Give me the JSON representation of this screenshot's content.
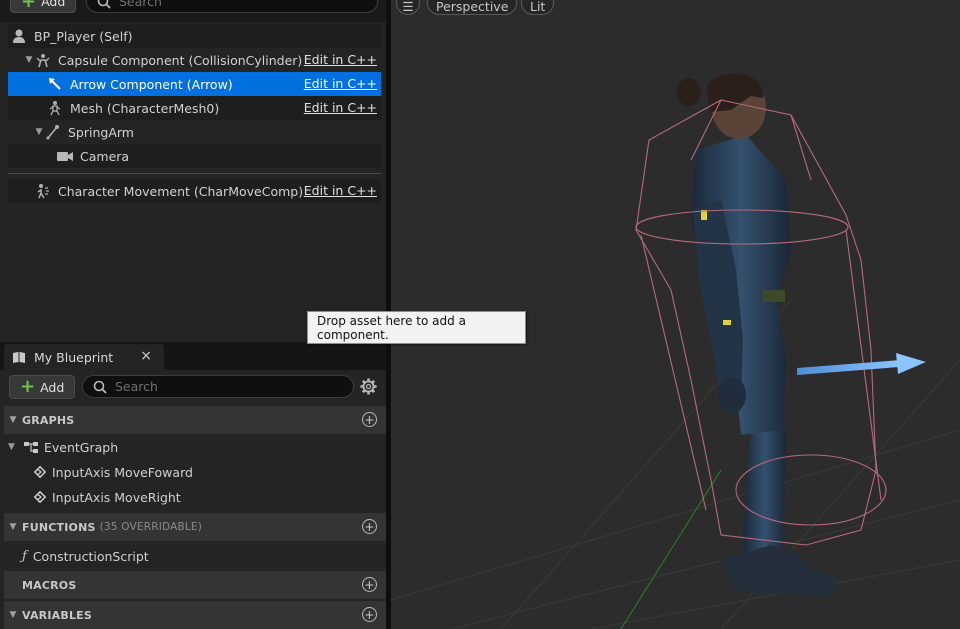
{
  "components_panel": {
    "add_label": "Add",
    "search_placeholder": "Search",
    "rows": [
      {
        "label": "BP_Player (Self)",
        "icon": "actor-icon",
        "edit": ""
      },
      {
        "label": "Capsule Component (CollisionCylinder)",
        "icon": "capsule-icon",
        "edit": "Edit in C++"
      },
      {
        "label": "Arrow Component (Arrow)",
        "icon": "arrow-component-icon",
        "edit": "Edit in C++",
        "selected": true
      },
      {
        "label": "Mesh (CharacterMesh0)",
        "icon": "skeletal-mesh-icon",
        "edit": "Edit in C++"
      },
      {
        "label": "SpringArm",
        "icon": "spring-arm-icon",
        "edit": ""
      },
      {
        "label": "Camera",
        "icon": "camera-icon",
        "edit": ""
      },
      {
        "label": "Character Movement (CharMoveComp)",
        "icon": "movement-icon",
        "edit": "Edit in C++"
      }
    ],
    "drop_tooltip": "Drop asset here to add a component."
  },
  "my_blueprint": {
    "tab_label": "My Blueprint",
    "close_glyph": "×",
    "add_label": "Add",
    "search_placeholder": "Search",
    "sections": {
      "graphs": "GRAPHS",
      "functions": "FUNCTIONS",
      "functions_sub": "(35 OVERRIDABLE)",
      "macros": "MACROS",
      "variables": "VARIABLES"
    },
    "graphs": {
      "event_graph": "EventGraph",
      "items": [
        "InputAxis MoveFoward",
        "InputAxis MoveRight"
      ]
    },
    "functions": [
      "ConstructionScript"
    ]
  },
  "viewport": {
    "menu_glyph": "☰",
    "perspective_label": "Perspective",
    "lit_label": "Lit"
  },
  "colors": {
    "selection": "#0070e0",
    "panel": "#242424",
    "viewport_bg": "#2c2c2c",
    "add_plus": "#6fc34a",
    "capsule_wire": "#b56a7a",
    "arrow": "#6aa8e8"
  }
}
